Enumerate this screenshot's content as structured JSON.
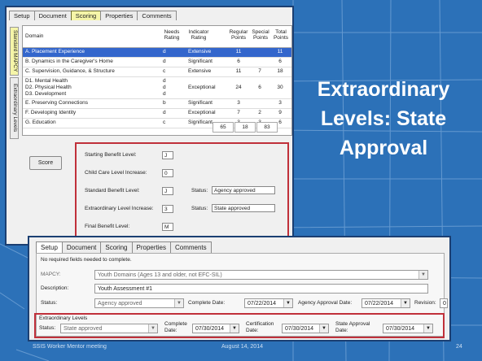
{
  "slide": {
    "title_lines": [
      "Extraordinary",
      "Levels: State",
      "Approval"
    ],
    "footer_left": "SSIS Worker Mentor meeting",
    "footer_mid": "August 14, 2014",
    "footer_page": "24"
  },
  "win1": {
    "tabs": [
      "Setup",
      "Document",
      "Scoring",
      "Properties",
      "Comments"
    ],
    "side_tabs": [
      "Standard MAPCY",
      "Extraordinary Levels"
    ],
    "headers": {
      "domain": "Domain",
      "needs": "Needs Rating",
      "indicator": "Indicator Rating",
      "regular": "Regular Points",
      "special": "Special Points",
      "total": "Total Points"
    },
    "rows": [
      {
        "domain": "A. Placement Experience",
        "needs": "d",
        "indicator": "Extensive",
        "regular": "11",
        "special": "",
        "total": "11"
      },
      {
        "domain": "B. Dynamics in the Caregiver's Home",
        "needs": "d",
        "indicator": "Significant",
        "regular": "6",
        "special": "",
        "total": "6"
      },
      {
        "domain": "C. Supervision, Guidance, & Structure",
        "needs": "c",
        "indicator": "Extensive",
        "regular": "11",
        "special": "7",
        "total": "18"
      },
      {
        "domain": "D1. Mental Health",
        "domain2": "D2. Physical Health",
        "domain3": "D3. Development",
        "needs": "d",
        "needs2": "d",
        "needs3": "d",
        "indicator": "Exceptional",
        "regular": "24",
        "special": "6",
        "total": "30"
      },
      {
        "domain": "E. Preserving Connections",
        "needs": "b",
        "indicator": "Significant",
        "regular": "3",
        "special": "",
        "total": "3"
      },
      {
        "domain": "F. Developing Identity",
        "needs": "d",
        "indicator": "Exceptional",
        "regular": "7",
        "special": "2",
        "total": "9"
      },
      {
        "domain": "G. Education",
        "needs": "c",
        "indicator": "Significant",
        "regular": "3",
        "special": "3",
        "total": "6"
      }
    ],
    "totals": [
      "65",
      "18",
      "83"
    ],
    "score_button": "Score",
    "fields": {
      "starting_label": "Starting Benefit Level:",
      "starting_value": "J",
      "childcare_label": "Child Care Level Increase:",
      "childcare_value": "0",
      "standard_label": "Standard Benefit Level:",
      "standard_value": "J",
      "status_label": "Status:",
      "standard_status": "Agency approved",
      "extra_label": "Extraordinary Level Increase:",
      "extra_value": "3",
      "extra_status": "State approved",
      "final_label": "Final Benefit Level:",
      "final_value": "M"
    }
  },
  "win2": {
    "tabs": [
      "Setup",
      "Document",
      "Scoring",
      "Properties",
      "Comments"
    ],
    "notice": "No required fields needed to complete.",
    "mapcy_label": "MAPCY:",
    "mapcy_value": "Youth Domains (Ages 13 and older, not EFC-SIL)",
    "description_label": "Description:",
    "description_value": "Youth Assessment #1",
    "status_label": "Status:",
    "status_value": "Agency approved",
    "complete_label": "Complete Date:",
    "complete_value": "07/22/2014",
    "agency_label": "Agency Approval Date:",
    "agency_value": "07/22/2014",
    "revision_label": "Revision:",
    "revision_value": "0",
    "extra_group": "Extraordinary Levels",
    "extra_status_label": "Status:",
    "extra_status_value": "State approved",
    "extra_complete_label1": "Complete",
    "extra_complete_label2": "Date:",
    "extra_complete_value": "07/30/2014",
    "cert_label1": "Certification",
    "cert_label2": "Date:",
    "cert_value": "07/30/2014",
    "state_label1": "State Approval",
    "state_label2": "Date:",
    "state_value": "07/30/2014"
  }
}
